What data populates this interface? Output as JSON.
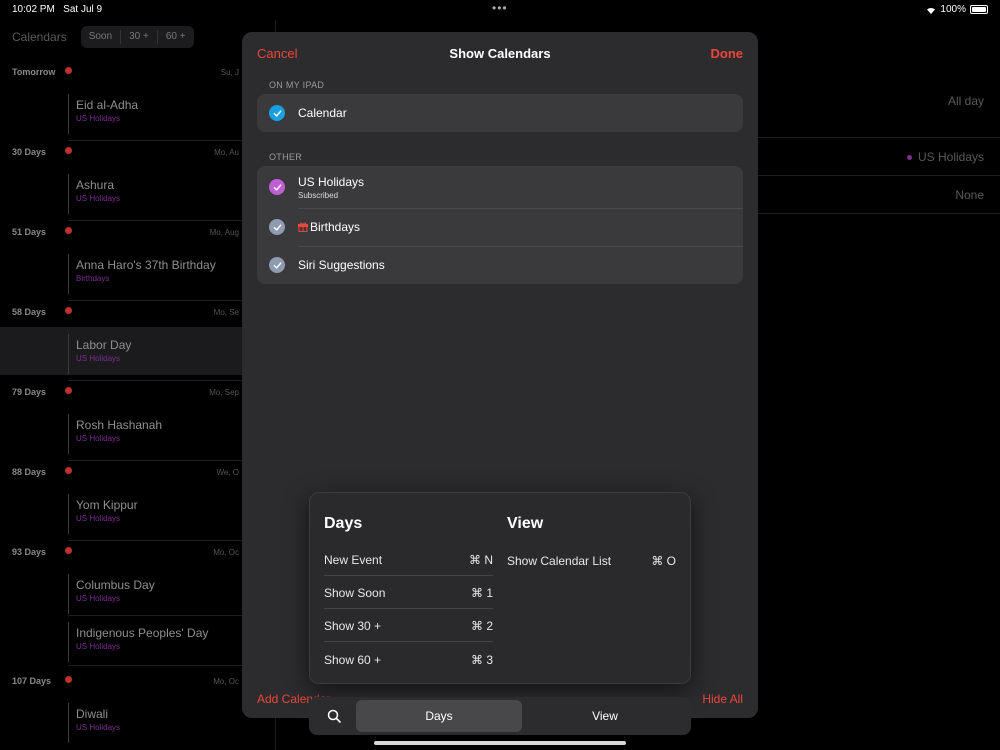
{
  "status": {
    "time": "10:02 PM",
    "date": "Sat Jul 9",
    "battery": "100%"
  },
  "left": {
    "title": "Calendars",
    "segments": [
      "Soon",
      "30 +",
      "60 +"
    ],
    "sections": [
      {
        "head": "Tomorrow",
        "date": "Su, J",
        "events": [
          {
            "title": "Eid al-Adha",
            "calendar": "US Holidays"
          }
        ]
      },
      {
        "head": "30 Days",
        "date": "Mo, Au",
        "events": [
          {
            "title": "Ashura",
            "calendar": "US Holidays"
          }
        ]
      },
      {
        "head": "51 Days",
        "date": "Mo, Aug",
        "events": [
          {
            "title": "Anna Haro's 37th Birthday",
            "calendar": "Birthdays"
          }
        ]
      },
      {
        "head": "58 Days",
        "date": "Mo, Se",
        "events": [
          {
            "title": "Labor Day",
            "calendar": "US Holidays"
          }
        ]
      },
      {
        "head": "79 Days",
        "date": "Mo, Sep",
        "events": [
          {
            "title": "Rosh Hashanah",
            "calendar": "US Holidays"
          }
        ]
      },
      {
        "head": "88 Days",
        "date": "We, O",
        "events": [
          {
            "title": "Yom Kippur",
            "calendar": "US Holidays"
          }
        ]
      },
      {
        "head": "93 Days",
        "date": "Mo, Oc",
        "events": [
          {
            "title": "Columbus Day",
            "calendar": "US Holidays"
          },
          {
            "title": "Indigenous Peoples' Day",
            "calendar": "US Holidays"
          }
        ]
      },
      {
        "head": "107 Days",
        "date": "Mo, Oc",
        "events": [
          {
            "title": "Diwali",
            "calendar": "US Holidays"
          }
        ]
      }
    ]
  },
  "right_bg": {
    "all_day": "All day",
    "calendar": "US Holidays",
    "alert": "None"
  },
  "modal": {
    "cancel": "Cancel",
    "title": "Show Calendars",
    "done": "Done",
    "section_ipad": "ON MY IPAD",
    "ipad_items": [
      {
        "label": "Calendar",
        "color": "#1a9fe0"
      }
    ],
    "section_other": "OTHER",
    "other_items": [
      {
        "label": "US Holidays",
        "sub": "Subscribed",
        "color": "#c05fd4"
      },
      {
        "label": "Birthdays",
        "icon": "gift-icon",
        "color": "#8e9bb0"
      },
      {
        "label": "Siri Suggestions",
        "color": "#8e9bb0"
      }
    ],
    "add_calendar": "Add Calendar",
    "hide_all": "Hide All"
  },
  "shortcuts": {
    "days": {
      "head": "Days",
      "rows": [
        {
          "label": "New Event",
          "key": "⌘ N"
        },
        {
          "label": "Show Soon",
          "key": "⌘ 1"
        },
        {
          "label": "Show 30 +",
          "key": "⌘ 2"
        },
        {
          "label": "Show 60 +",
          "key": "⌘ 3"
        }
      ]
    },
    "view": {
      "head": "View",
      "rows": [
        {
          "label": "Show Calendar List",
          "key": "⌘ O"
        }
      ]
    }
  },
  "tabbar": {
    "tabs": [
      "Days",
      "View"
    ],
    "active": "Days"
  },
  "colors": {
    "accent": "#f0453a",
    "modal_bg": "#2c2c2e",
    "group_bg": "#3a3a3c"
  }
}
